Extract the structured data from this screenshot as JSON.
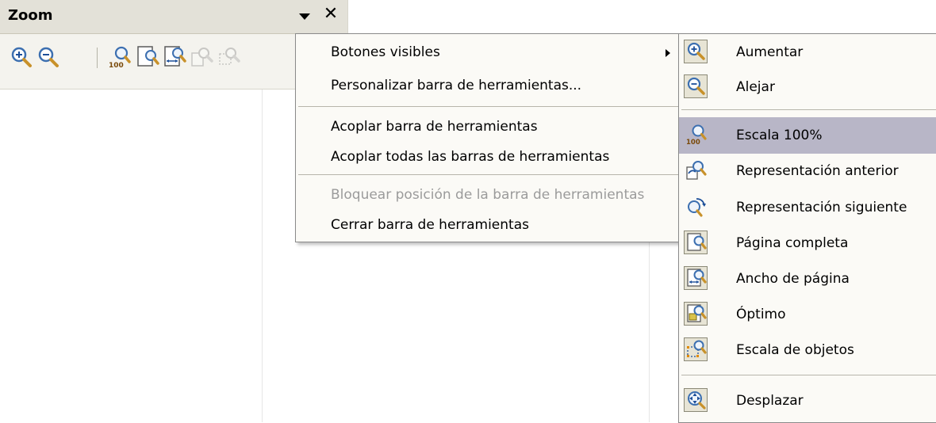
{
  "toolbar": {
    "title": "Zoom",
    "close_glyph": "✕",
    "icons": [
      "zoom-in-icon",
      "zoom-out-icon",
      "zoom-100-icon",
      "page-complete-icon",
      "page-width-icon",
      "optimal-view-icon",
      "object-zoom-icon"
    ]
  },
  "context_menu": {
    "items": [
      {
        "label": "Botones visibles",
        "has_submenu": true,
        "enabled": true
      },
      {
        "label": "Personalizar barra de herramientas...",
        "enabled": true
      },
      {
        "label": "Acoplar barra de herramientas",
        "enabled": true
      },
      {
        "label": "Acoplar todas las barras de herramientas",
        "enabled": true
      },
      {
        "label": "Bloquear posición de la barra de herramientas",
        "enabled": false
      },
      {
        "label": "Cerrar barra de herramientas",
        "enabled": true
      }
    ]
  },
  "submenu": {
    "items": [
      {
        "label": "Aumentar",
        "checked": true,
        "icon": "zoom-in-icon"
      },
      {
        "label": "Alejar",
        "checked": true,
        "icon": "zoom-out-icon"
      },
      {
        "label": "Escala 100%",
        "checked": false,
        "selected": true,
        "icon": "zoom-100-icon"
      },
      {
        "label": "Representación anterior",
        "checked": false,
        "icon": "previous-view-icon"
      },
      {
        "label": "Representación siguiente",
        "checked": false,
        "icon": "next-view-icon"
      },
      {
        "label": "Página completa",
        "checked": true,
        "icon": "page-complete-icon"
      },
      {
        "label": "Ancho de página",
        "checked": true,
        "icon": "page-width-icon"
      },
      {
        "label": "Óptimo",
        "checked": true,
        "icon": "optimal-view-icon"
      },
      {
        "label": "Escala de objetos",
        "checked": true,
        "icon": "object-zoom-icon"
      },
      {
        "label": "Desplazar",
        "checked": true,
        "icon": "pan-icon"
      }
    ]
  },
  "colors": {
    "highlight": "#b8b6c7",
    "toolbar_bg": "#f4f3ee",
    "menu_bg": "#fbfaf6",
    "disabled_text": "#9b9b9b"
  }
}
